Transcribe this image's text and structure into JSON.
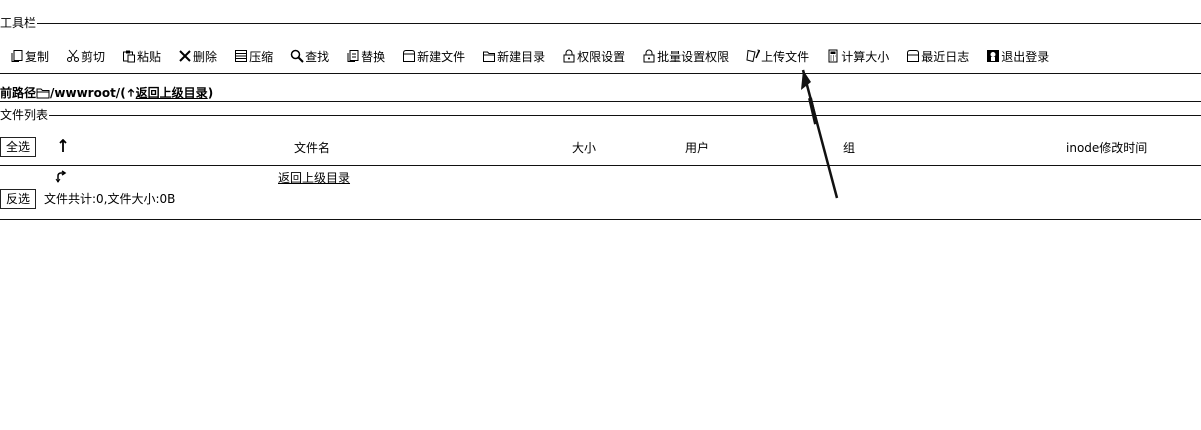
{
  "toolbar": {
    "legend": "工具栏",
    "items": [
      {
        "label": "复制",
        "icon": "copy-icon"
      },
      {
        "label": "剪切",
        "icon": "scissors-icon"
      },
      {
        "label": "粘贴",
        "icon": "paste-icon"
      },
      {
        "label": "删除",
        "icon": "delete-icon"
      },
      {
        "label": "压缩",
        "icon": "compress-icon"
      },
      {
        "label": "查找",
        "icon": "search-icon"
      },
      {
        "label": "替换",
        "icon": "replace-icon"
      },
      {
        "label": "新建文件",
        "icon": "new-file-icon"
      },
      {
        "label": "新建目录",
        "icon": "new-folder-icon"
      },
      {
        "label": "权限设置",
        "icon": "lock-icon"
      },
      {
        "label": "批量设置权限",
        "icon": "lock-icon"
      },
      {
        "label": "上传文件",
        "icon": "upload-icon"
      },
      {
        "label": "计算大小",
        "icon": "calculator-icon"
      },
      {
        "label": "最近日志",
        "icon": "log-icon"
      },
      {
        "label": "退出登录",
        "icon": "logout-icon"
      }
    ]
  },
  "path": {
    "label": "前路径",
    "value": "/wwwroot/",
    "paren_open": "(",
    "back_link": "返回上级目录",
    "paren_close": ")"
  },
  "filelist": {
    "legend": "文件列表",
    "select_all": "全选",
    "sort_icon": "up-arrow-icon",
    "columns": [
      "文件名",
      "大小",
      "用户",
      "组",
      "inode修改时间"
    ],
    "rows": [
      {
        "icon": "parent-dir-icon",
        "name": "返回上级目录"
      }
    ],
    "invert": "反选",
    "summary": "文件共计:0,文件大小:0B"
  }
}
